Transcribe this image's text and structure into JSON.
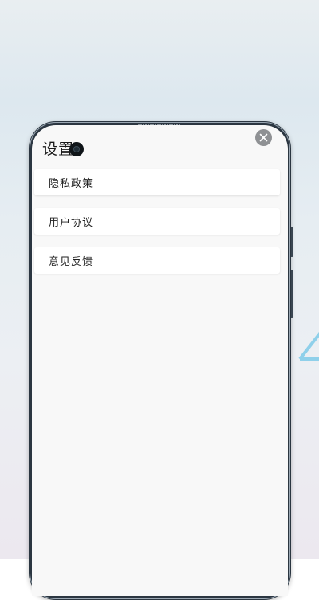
{
  "screen": {
    "title": "设置",
    "close_icon": "close-icon"
  },
  "menu": {
    "items": [
      {
        "label": "隐私政策"
      },
      {
        "label": "用户协议"
      },
      {
        "label": "意见反馈"
      }
    ]
  },
  "colors": {
    "screen_bg": "#f8f8f8",
    "item_bg": "#ffffff",
    "close_button": "#8f9194",
    "phone_frame": "#2b3641",
    "accent_triangle": "#8fd0ea"
  }
}
